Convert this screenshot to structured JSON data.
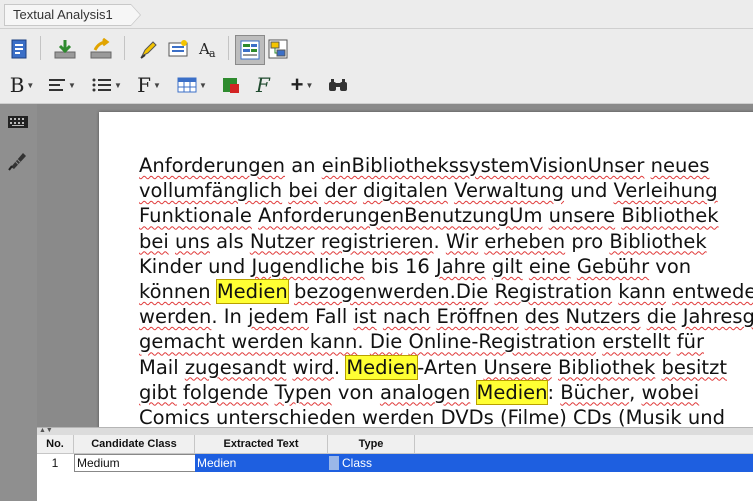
{
  "tab": {
    "title": "Textual Analysis1"
  },
  "toolbar1": {
    "icons": [
      "document-icon",
      "import-icon",
      "export-icon",
      "highlighter-icon",
      "comment-icon",
      "font-case-icon",
      "grid-view-icon",
      "class-diagram-icon"
    ]
  },
  "toolbar2": {
    "bold_label": "B",
    "font_label": "F",
    "icons": [
      "bold-icon",
      "align-icon",
      "list-icon",
      "font-icon",
      "table-icon",
      "color-icon",
      "style-icon",
      "add-icon",
      "find-icon"
    ]
  },
  "leftbar": {
    "icons": [
      "keyboard-icon",
      "pen-icon"
    ]
  },
  "document": {
    "lines": [
      [
        {
          "t": "Anforderungen",
          "s": "w"
        },
        {
          "t": " an "
        },
        {
          "t": "einBibliothekssystemVisionUnser",
          "s": "w"
        },
        {
          "t": " "
        },
        {
          "t": "neues",
          "s": "w"
        }
      ],
      [
        {
          "t": "vollumfänglich",
          "s": "w"
        },
        {
          "t": " "
        },
        {
          "t": "bei",
          "s": "w"
        },
        {
          "t": " "
        },
        {
          "t": "der",
          "s": "w"
        },
        {
          "t": " "
        },
        {
          "t": "digitalen",
          "s": "w"
        },
        {
          "t": " "
        },
        {
          "t": "Verwaltung",
          "s": "w"
        },
        {
          "t": " und "
        },
        {
          "t": "Verleihung",
          "s": "w"
        }
      ],
      [
        {
          "t": "Funktionale",
          "s": "w"
        },
        {
          "t": " "
        },
        {
          "t": "AnforderungenBenutzungUm",
          "s": "w"
        },
        {
          "t": " "
        },
        {
          "t": "unsere",
          "s": "w"
        },
        {
          "t": " "
        },
        {
          "t": "Bibliothek",
          "s": "w"
        }
      ],
      [
        {
          "t": "bei",
          "s": "w"
        },
        {
          "t": " "
        },
        {
          "t": "uns",
          "s": "w"
        },
        {
          "t": " als "
        },
        {
          "t": "Nutzer",
          "s": "w"
        },
        {
          "t": " "
        },
        {
          "t": "registrieren",
          "s": "w"
        },
        {
          "t": ". "
        },
        {
          "t": "Wir",
          "s": "w"
        },
        {
          "t": " "
        },
        {
          "t": "erheben",
          "s": "w"
        },
        {
          "t": " pro "
        },
        {
          "t": "Bibliothek",
          "s": "w"
        }
      ],
      [
        {
          "t": "Kinder und "
        },
        {
          "t": "Jugendliche",
          "s": "w"
        },
        {
          "t": " bis 16 "
        },
        {
          "t": "Jahre",
          "s": "w"
        },
        {
          "t": " "
        },
        {
          "t": "gilt",
          "s": "w"
        },
        {
          "t": " "
        },
        {
          "t": "eine",
          "s": "w"
        },
        {
          "t": " "
        },
        {
          "t": "Gebühr",
          "s": "w"
        },
        {
          "t": " von"
        }
      ],
      [
        {
          "t": "können",
          "s": "w"
        },
        {
          "t": " "
        },
        {
          "t": "Medien",
          "s": "hl"
        },
        {
          "t": " "
        },
        {
          "t": "bezogenwerden.Die",
          "s": "w"
        },
        {
          "t": " "
        },
        {
          "t": "Registration",
          "s": "w"
        },
        {
          "t": " "
        },
        {
          "t": "kann",
          "s": "w"
        },
        {
          "t": " "
        },
        {
          "t": "entweder",
          "s": "w"
        }
      ],
      [
        {
          "t": "werden",
          "s": "w"
        },
        {
          "t": ". In "
        },
        {
          "t": "jedem",
          "s": "w"
        },
        {
          "t": " Fall "
        },
        {
          "t": "ist",
          "s": "w"
        },
        {
          "t": " "
        },
        {
          "t": "nach",
          "s": "w"
        },
        {
          "t": " "
        },
        {
          "t": "Eröffnen",
          "s": "w"
        },
        {
          "t": " "
        },
        {
          "t": "des",
          "s": "w"
        },
        {
          "t": " "
        },
        {
          "t": "Nutzers",
          "s": "w"
        },
        {
          "t": " "
        },
        {
          "t": "die",
          "s": "w"
        },
        {
          "t": " "
        },
        {
          "t": "Jahresgebühr",
          "s": "w"
        }
      ],
      [
        {
          "t": "gemacht werden kann",
          "s": "w"
        },
        {
          "t": ". "
        },
        {
          "t": "Die",
          "s": "w"
        },
        {
          "t": " "
        },
        {
          "t": "Online-Registration",
          "s": "w"
        },
        {
          "t": " "
        },
        {
          "t": "erstellt",
          "s": "w"
        },
        {
          "t": " "
        },
        {
          "t": "für",
          "s": "w"
        }
      ],
      [
        {
          "t": "Mail "
        },
        {
          "t": "zugesandt",
          "s": "w"
        },
        {
          "t": " "
        },
        {
          "t": "wird",
          "s": "w"
        },
        {
          "t": ". "
        },
        {
          "t": "Medien",
          "s": "hl"
        },
        {
          "t": "-Arten "
        },
        {
          "t": "Unsere",
          "s": "w"
        },
        {
          "t": " "
        },
        {
          "t": "Bibliothek",
          "s": "w"
        },
        {
          "t": " "
        },
        {
          "t": "besitzt",
          "s": "w"
        }
      ],
      [
        {
          "t": "gibt",
          "s": "w"
        },
        {
          "t": " "
        },
        {
          "t": "folgende",
          "s": "w"
        },
        {
          "t": " "
        },
        {
          "t": "Typen",
          "s": "w"
        },
        {
          "t": " von "
        },
        {
          "t": "analogen",
          "s": "w"
        },
        {
          "t": " "
        },
        {
          "t": "Medien",
          "s": "hl"
        },
        {
          "t": ": "
        },
        {
          "t": "Bücher",
          "s": "w"
        },
        {
          "t": ", "
        },
        {
          "t": "wobei",
          "s": "w"
        }
      ],
      [
        {
          "t": "Comics",
          "s": "w"
        },
        {
          "t": " "
        },
        {
          "t": "unterschieden",
          "s": "w"
        },
        {
          "t": " "
        },
        {
          "t": "werden",
          "s": "w"
        },
        {
          "t": " DVDs (Filme) CDs (Musik und"
        }
      ]
    ]
  },
  "table": {
    "headers": {
      "no": "No.",
      "candidate": "Candidate Class",
      "extracted": "Extracted Text",
      "type": "Type"
    },
    "rows": [
      {
        "no": "1",
        "candidate": "Medium",
        "extracted": "Medien",
        "type": "Class"
      }
    ],
    "selection_color": "#1e5fe0"
  }
}
